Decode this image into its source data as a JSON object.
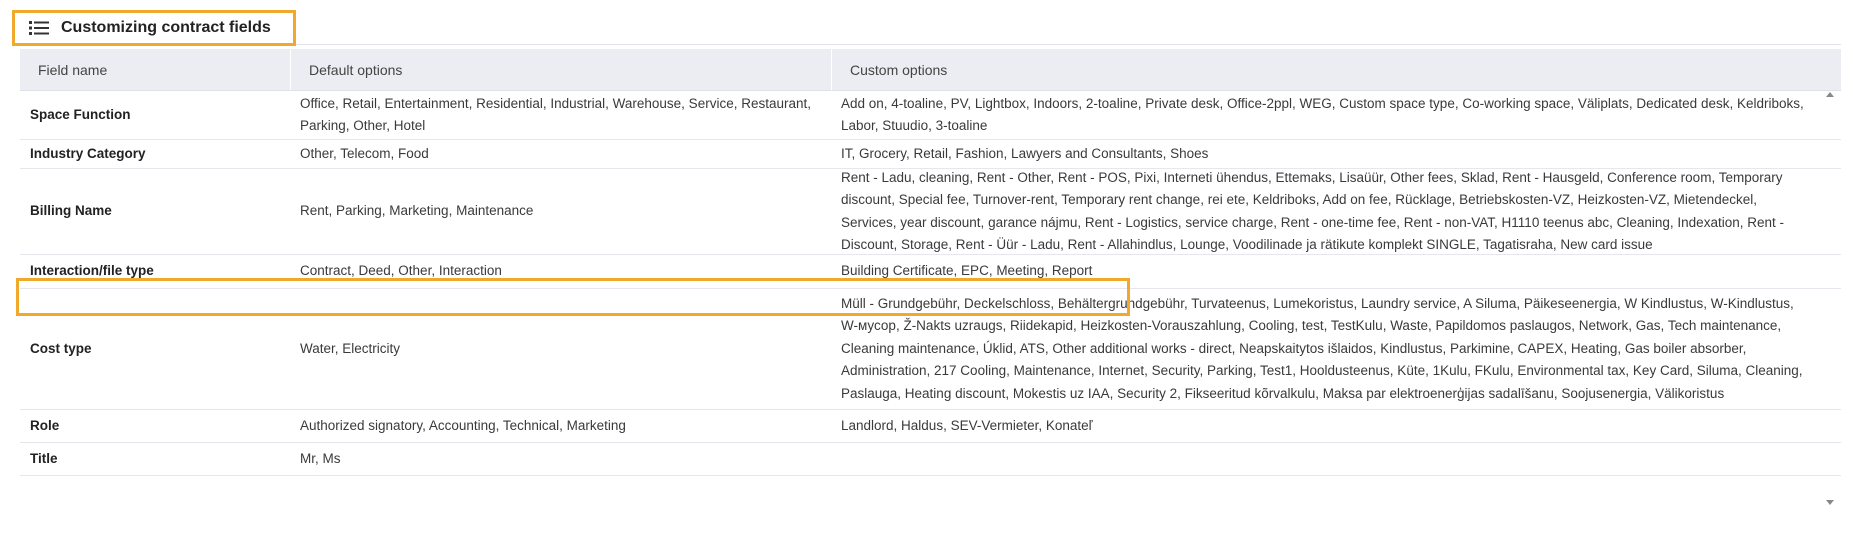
{
  "header": {
    "title": "Customizing contract fields",
    "icon": "list-icon"
  },
  "table": {
    "columns": [
      "Field name",
      "Default options",
      "Custom options"
    ],
    "rows": [
      {
        "field": "Space Function",
        "default": "Office, Retail, Entertainment, Residential, Industrial, Warehouse, Service, Restaurant, Parking, Other, Hotel",
        "custom": "Add on, 4-toaline, PV, Lightbox, Indoors, 2-toaline, Private desk, Office-2ppl, WEG, Custom space type, Co-working space, Väliplats, Dedicated desk, Keldriboks, Labor, Stuudio, 3-toaline"
      },
      {
        "field": "Industry Category",
        "default": "Other, Telecom, Food",
        "custom": "IT, Grocery, Retail, Fashion, Lawyers and Consultants, Shoes"
      },
      {
        "field": "Billing Name",
        "default": "Rent, Parking, Marketing, Maintenance",
        "custom": "Rent - Ladu, cleaning, Rent - Other, Rent - POS, Pixi, Interneti ühendus, Ettemaks, Lisaüür, Other fees, Sklad, Rent - Hausgeld, Conference room, Temporary discount, Special fee, Turnover-rent, Temporary rent change, rei ete, Keldriboks, Add on fee, Rücklage, Betriebskosten-VZ, Heizkosten-VZ, Mietendeckel, Services, year discount, garance nájmu, Rent - Logistics, service charge, Rent - one-time fee, Rent - non-VAT, H1110 teenus abc, Cleaning, Indexation, Rent - Discount, Storage, Rent - Üür - Ladu, Rent - Allahindlus, Lounge, Voodilinade ja rätikute komplekt SINGLE, Tagatisraha, New card issue"
      },
      {
        "field": "Interaction/file type",
        "default": "Contract, Deed, Other, Interaction",
        "custom": "Building Certificate, EPC, Meeting, Report"
      },
      {
        "field": "Cost type",
        "default": "Water, Electricity",
        "custom": "Müll - Grundgebühr, Deckelschloss, Behältergrundgebühr, Turvateenus, Lumekoristus, Laundry service, A Siluma, Päikeseenergia, W Kindlustus, W-Kindlustus, W-мусор, Ž-Nakts uzraugs, Riidekapid, Heizkosten-Vorauszahlung, Cooling, test, TestKulu, Waste, Papildomos paslaugos, Network, Gas, Tech maintenance, Cleaning maintenance, Úklid, ATS, Other additional works - direct, Neapskaitytos išlaidos, Kindlustus, Parkimine, CAPEX, Heating, Gas boiler absorber, Administration, 217 Cooling, Maintenance, Internet, Security, Parking, Test1, Hooldusteenus, Küte, 1Kulu, FKulu, Environmental tax, Key Card, Siluma, Cleaning, Paslauga, Heating discount, Mokestis uz IAA, Security 2, Fikseeritud kõrvalkulu, Maksa par elektroenerģijas sadalīšanu, Soojusenergia, Välikoristus"
      },
      {
        "field": "Role",
        "default": "Authorized signatory, Accounting, Technical, Marketing",
        "custom": "Landlord, Haldus, SEV-Vermieter, Konateľ"
      },
      {
        "field": "Title",
        "default": "Mr, Ms",
        "custom": ""
      }
    ]
  },
  "colors": {
    "highlight": "#f0a92a",
    "header_bg": "#ececf3"
  }
}
